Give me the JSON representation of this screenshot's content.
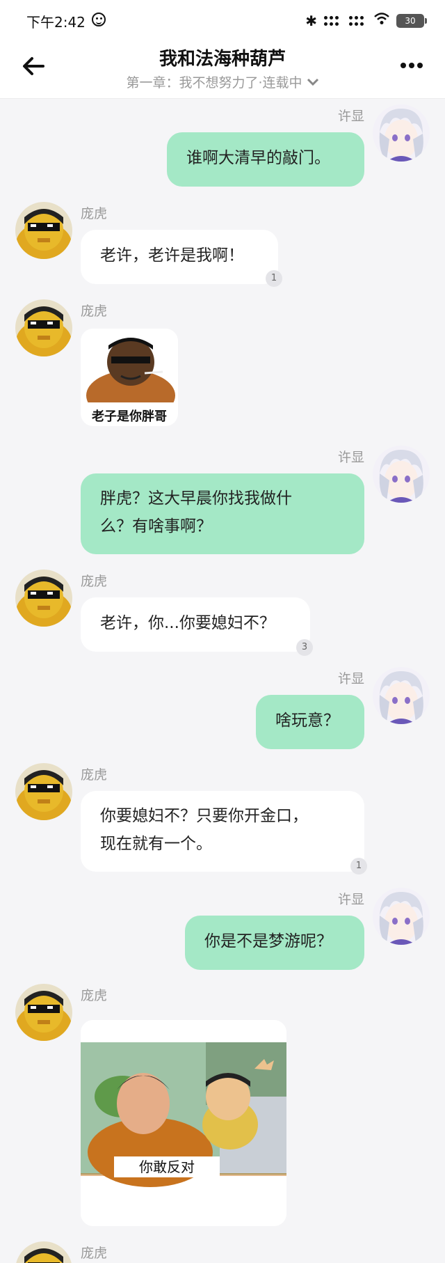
{
  "status_bar": {
    "time": "下午2:42",
    "battery": "30"
  },
  "header": {
    "title": "我和法海种葫芦",
    "subtitle": "第一章：我不想努力了·连载中"
  },
  "messages": [
    {
      "sender": "许显",
      "side": "right",
      "text": "谁啊大清早的敲门。"
    },
    {
      "sender": "庞虎",
      "side": "left",
      "text": "老许，老许是我啊！",
      "count": "1"
    },
    {
      "sender": "庞虎",
      "side": "left",
      "image_caption": "老子是你胖哥"
    },
    {
      "sender": "许显",
      "side": "right",
      "lines": [
        "胖虎？这大早晨你找我做什",
        "么？有啥事啊？"
      ]
    },
    {
      "sender": "庞虎",
      "side": "left",
      "text": "老许，你...你要媳妇不？",
      "count": "3"
    },
    {
      "sender": "许显",
      "side": "right",
      "text": "啥玩意？"
    },
    {
      "sender": "庞虎",
      "side": "left",
      "lines": [
        "你要媳妇不？只要你开金口，",
        "现在就有一个。"
      ],
      "count": "1"
    },
    {
      "sender": "许显",
      "side": "right",
      "text": "你是不是梦游呢？"
    },
    {
      "sender": "庞虎",
      "side": "left",
      "image_caption": "你敢反对"
    },
    {
      "sender": "庞虎",
      "side": "left"
    }
  ],
  "icons": {
    "back": "arrow-left-icon",
    "more": "more-dots-icon",
    "chevron": "chevron-down-icon"
  },
  "colors": {
    "self_bubble": "#a4e8c6",
    "other_bubble": "#ffffff",
    "background": "#f5f5f7"
  }
}
